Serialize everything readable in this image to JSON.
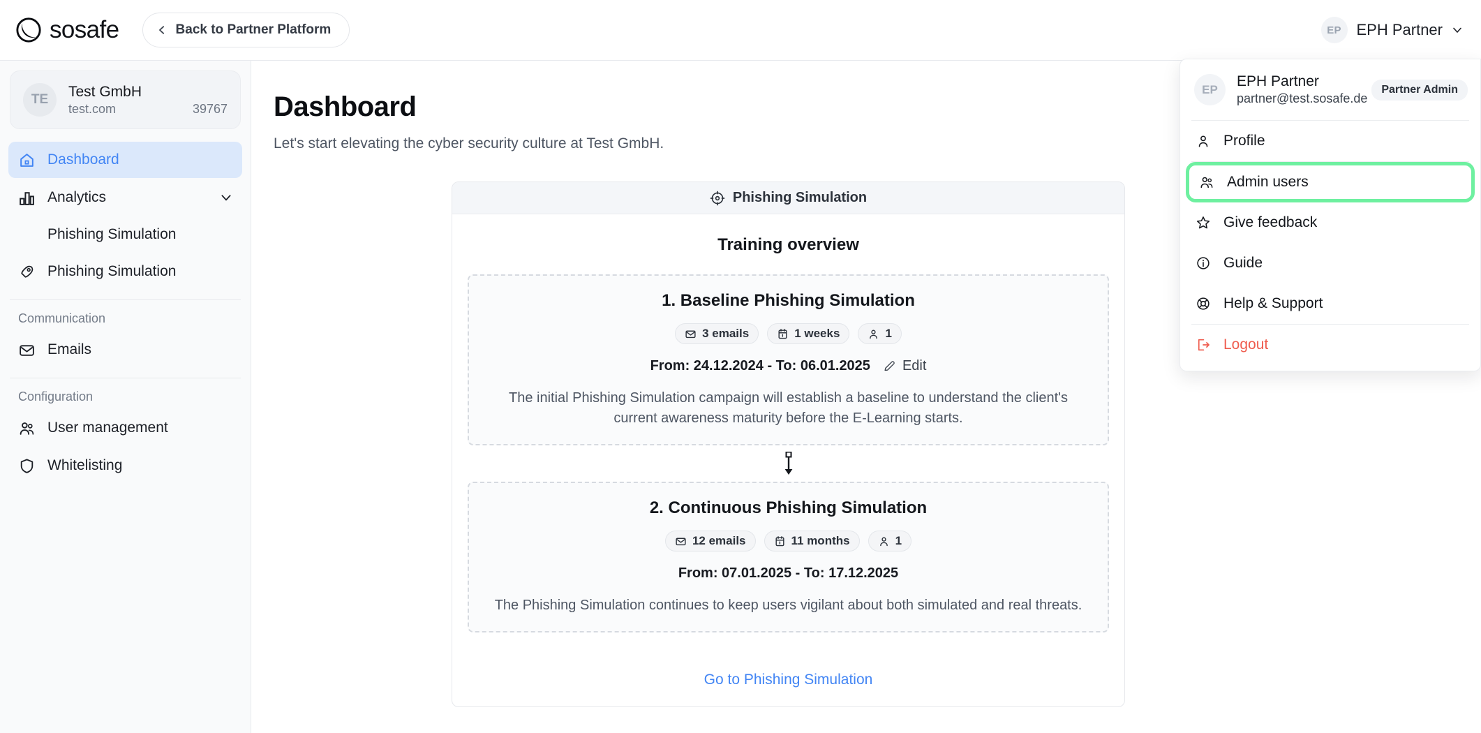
{
  "topbar": {
    "brand": "sosafe",
    "back_label": "Back to Partner Platform",
    "user_initials": "EP",
    "user_name": "EPH Partner"
  },
  "sidebar": {
    "org": {
      "initials": "TE",
      "name": "Test GmbH",
      "domain": "test.com",
      "id": "39767"
    },
    "items": [
      {
        "label": "Dashboard",
        "icon": "home-icon",
        "active": true
      },
      {
        "label": "Analytics",
        "icon": "bar-chart-icon",
        "active": false,
        "caret": "chevron-down-icon"
      }
    ],
    "analytics_sub": [
      {
        "label": "Phishing Simulation"
      }
    ],
    "phishing": {
      "label": "Phishing Simulation",
      "icon": "rocket-icon"
    },
    "sections": [
      {
        "title": "Communication",
        "items": [
          {
            "label": "Emails",
            "icon": "mail-icon"
          }
        ]
      },
      {
        "title": "Configuration",
        "items": [
          {
            "label": "User management",
            "icon": "users-icon"
          },
          {
            "label": "Whitelisting",
            "icon": "shield-icon"
          }
        ]
      }
    ]
  },
  "main": {
    "title": "Dashboard",
    "subtitle": "Let's start elevating the cyber security culture at Test GmbH.",
    "panel": {
      "header": "Phishing Simulation",
      "header_icon": "target-icon",
      "overview_title": "Training overview",
      "campaigns": [
        {
          "title": "1. Baseline Phishing Simulation",
          "badges": [
            {
              "icon": "mail-icon",
              "text": "3 emails"
            },
            {
              "icon": "calendar-icon",
              "text": "1 weeks"
            },
            {
              "icon": "user-icon",
              "text": "1"
            }
          ],
          "dates": "From: 24.12.2024 - To: 06.01.2025",
          "edit_label": "Edit",
          "description": "The initial Phishing Simulation campaign will establish a baseline to understand the client's current awareness maturity before the E-Learning starts."
        },
        {
          "title": "2. Continuous Phishing Simulation",
          "badges": [
            {
              "icon": "mail-icon",
              "text": "12 emails"
            },
            {
              "icon": "calendar-icon",
              "text": "11 months"
            },
            {
              "icon": "user-icon",
              "text": "1"
            }
          ],
          "dates": "From: 07.01.2025 - To: 17.12.2025",
          "edit_label": "",
          "description": "The Phishing Simulation continues to keep users vigilant about both simulated and real threats."
        }
      ],
      "footer_link": "Go to Phishing Simulation"
    }
  },
  "user_menu": {
    "initials": "EP",
    "name": "EPH Partner",
    "email": "partner@test.sosafe.de",
    "role": "Partner Admin",
    "items": [
      {
        "label": "Profile",
        "icon": "user-icon",
        "highlight": false
      },
      {
        "label": "Admin users",
        "icon": "users-icon",
        "highlight": true
      },
      {
        "label": "Give feedback",
        "icon": "star-icon",
        "highlight": false
      },
      {
        "label": "Guide",
        "icon": "info-icon",
        "highlight": false
      },
      {
        "label": "Help & Support",
        "icon": "lifebuoy-icon",
        "highlight": false
      }
    ],
    "logout": {
      "label": "Logout",
      "icon": "logout-icon"
    }
  },
  "colors": {
    "accent_blue": "#4285f4",
    "highlight_green": "#6ef0a0",
    "logout_red": "#ef5c4e",
    "active_nav_bg": "#dbe8fb"
  }
}
